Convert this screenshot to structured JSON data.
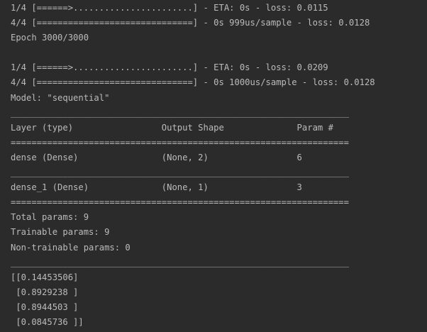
{
  "console": {
    "lines": [
      "1/4 [======>.......................] - ETA: 0s - loss: 0.0115",
      "4/4 [==============================] - 0s 999us/sample - loss: 0.0128",
      "Epoch 3000/3000",
      "",
      "1/4 [======>.......................] - ETA: 0s - loss: 0.0209",
      "4/4 [==============================] - 0s 1000us/sample - loss: 0.0128",
      "Model: \"sequential\"",
      "_________________________________________________________________",
      "Layer (type)                 Output Shape              Param #   ",
      "=================================================================",
      "dense (Dense)                (None, 2)                 6         ",
      "_________________________________________________________________",
      "dense_1 (Dense)              (None, 1)                 3         ",
      "=================================================================",
      "Total params: 9",
      "Trainable params: 9",
      "Non-trainable params: 0",
      "_________________________________________________________________",
      "[[0.14453506]",
      " [0.8929238 ]",
      " [0.8944503 ]",
      " [0.0845736 ]]"
    ]
  },
  "colors": {
    "background": "#2b2b2b",
    "text": "#bbbbbb"
  }
}
